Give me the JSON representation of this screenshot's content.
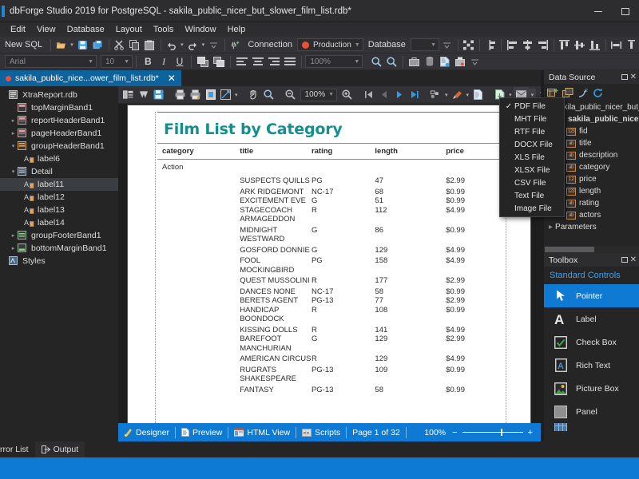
{
  "window": {
    "title": "dbForge Studio 2019 for PostgreSQL - sakila_public_nicer_but_slower_film_list.rdb*",
    "minimize": "minimize",
    "maximize": "maximize"
  },
  "menu": {
    "items": [
      "Edit",
      "View",
      "Database",
      "Layout",
      "Tools",
      "Window",
      "Help"
    ]
  },
  "toolbar_main": {
    "new_sql": "New SQL",
    "connection_label": "Connection",
    "connection_value": "Production",
    "database_label": "Database",
    "database_value": ""
  },
  "toolbar_format": {
    "font_family": "Arial",
    "font_size": "10",
    "bold": "B",
    "italic": "I",
    "underline": "U",
    "zoom_value": "100%"
  },
  "document_tab": {
    "label": "sakila_public_nice...ower_film_list.rdb*",
    "close": "✕"
  },
  "tree": {
    "items": [
      {
        "label": "XtraReport.rdb",
        "indent": 0,
        "expander": "",
        "icon": "report-icon",
        "selected": false
      },
      {
        "label": "topMarginBand1",
        "indent": 1,
        "expander": "",
        "icon": "band-icon",
        "selected": false
      },
      {
        "label": "reportHeaderBand1",
        "indent": 1,
        "expander": "▸",
        "icon": "band-icon",
        "selected": false
      },
      {
        "label": "pageHeaderBand1",
        "indent": 1,
        "expander": "▸",
        "icon": "band-icon",
        "selected": false
      },
      {
        "label": "groupHeaderBand1",
        "indent": 1,
        "expander": "▾",
        "icon": "band-icon",
        "selected": false
      },
      {
        "label": "label6",
        "indent": 2,
        "expander": "",
        "icon": "label-icon",
        "selected": false
      },
      {
        "label": "Detail",
        "indent": 1,
        "expander": "▾",
        "icon": "band-icon",
        "selected": false
      },
      {
        "label": "label11",
        "indent": 2,
        "expander": "",
        "icon": "label-icon",
        "selected": true
      },
      {
        "label": "label12",
        "indent": 2,
        "expander": "",
        "icon": "label-icon",
        "selected": false
      },
      {
        "label": "label13",
        "indent": 2,
        "expander": "",
        "icon": "label-icon",
        "selected": false
      },
      {
        "label": "label14",
        "indent": 2,
        "expander": "",
        "icon": "label-icon",
        "selected": false
      },
      {
        "label": "groupFooterBand1",
        "indent": 1,
        "expander": "▸",
        "icon": "band-icon",
        "selected": false
      },
      {
        "label": "bottomMarginBand1",
        "indent": 1,
        "expander": "▸",
        "icon": "band-icon",
        "selected": false
      },
      {
        "label": "Styles",
        "indent": 0,
        "expander": "",
        "icon": "styles-icon",
        "selected": false
      }
    ]
  },
  "preview_toolbar": {
    "zoom_value": "100%"
  },
  "export_menu": {
    "checked_index": 0,
    "items": [
      "PDF File",
      "MHT File",
      "RTF File",
      "DOCX File",
      "XLS File",
      "XLSX File",
      "CSV File",
      "Text File",
      "Image File"
    ]
  },
  "report": {
    "title": "Film List by Category",
    "columns": [
      "category",
      "title",
      "rating",
      "length",
      "price"
    ],
    "group": "Action",
    "rows": [
      {
        "title": "SUSPECTS QUILLS",
        "rating": "PG",
        "length": "47",
        "price": "$2.99"
      },
      {
        "title": "ARK RIDGEMONT",
        "rating": "NC-17",
        "length": "68",
        "price": "$0.99"
      },
      {
        "title": "EXCITEMENT EVE",
        "rating": "G",
        "length": "51",
        "price": "$0.99"
      },
      {
        "title": "STAGECOACH ARMAGEDDON",
        "rating": "R",
        "length": "112",
        "price": "$4.99"
      },
      {
        "title": "MIDNIGHT WESTWARD",
        "rating": "G",
        "length": "86",
        "price": "$0.99"
      },
      {
        "title": "GOSFORD DONNIE",
        "rating": "G",
        "length": "129",
        "price": "$4.99"
      },
      {
        "title": "FOOL MOCKINGBIRD",
        "rating": "PG",
        "length": "158",
        "price": "$4.99"
      },
      {
        "title": "QUEST MUSSOLINI",
        "rating": "R",
        "length": "177",
        "price": "$2.99"
      },
      {
        "title": "DANCES NONE",
        "rating": "NC-17",
        "length": "58",
        "price": "$0.99"
      },
      {
        "title": "BERETS AGENT",
        "rating": "PG-13",
        "length": "77",
        "price": "$2.99"
      },
      {
        "title": "HANDICAP BOONDOCK",
        "rating": "R",
        "length": "108",
        "price": "$0.99"
      },
      {
        "title": "KISSING DOLLS",
        "rating": "R",
        "length": "141",
        "price": "$4.99"
      },
      {
        "title": "BAREFOOT MANCHURIAN",
        "rating": "G",
        "length": "129",
        "price": "$2.99"
      },
      {
        "title": "AMERICAN CIRCUS",
        "rating": "R",
        "length": "129",
        "price": "$4.99"
      },
      {
        "title": "RUGRATS SHAKESPEARE",
        "rating": "PG-13",
        "length": "109",
        "price": "$0.99"
      },
      {
        "title": "FANTASY",
        "rating": "PG-13",
        "length": "58",
        "price": "$0.99"
      }
    ]
  },
  "statusbar": {
    "designer": "Designer",
    "preview": "Preview",
    "html_view": "HTML View",
    "scripts": "Scripts",
    "page_info": "Page 1 of 32",
    "zoom": "100%",
    "zoom_out": "−",
    "zoom_in": "+"
  },
  "data_source_panel": {
    "title": "Data Source",
    "root": "sakila_public_nicer_but_slo",
    "table": "sakila_public_nicer",
    "fields": [
      {
        "label": "fid",
        "type": "123"
      },
      {
        "label": "title",
        "type": "ab"
      },
      {
        "label": "description",
        "type": "ab"
      },
      {
        "label": "category",
        "type": "ab"
      },
      {
        "label": "price",
        "type": "1.2"
      },
      {
        "label": "length",
        "type": "123"
      },
      {
        "label": "rating",
        "type": "ab"
      },
      {
        "label": "actors",
        "type": "ab"
      }
    ],
    "parameters": "Parameters"
  },
  "toolbox_panel": {
    "title": "Toolbox",
    "category": "Standard Controls",
    "items": [
      {
        "label": "Pointer",
        "icon": "pointer-icon",
        "selected": true
      },
      {
        "label": "Label",
        "icon": "label-icon",
        "selected": false
      },
      {
        "label": "Check Box",
        "icon": "checkbox-icon",
        "selected": false
      },
      {
        "label": "Rich Text",
        "icon": "richtext-icon",
        "selected": false
      },
      {
        "label": "Picture Box",
        "icon": "picturebox-icon",
        "selected": false
      },
      {
        "label": "Panel",
        "icon": "panel-icon",
        "selected": false
      }
    ]
  },
  "bottom_tabs": {
    "items": [
      "rror List",
      "Output"
    ]
  },
  "colors": {
    "accent": "#0e7ad4",
    "report_title": "#148f8f",
    "tab_active": "#0e639c",
    "status_dot": "#e8503a"
  }
}
